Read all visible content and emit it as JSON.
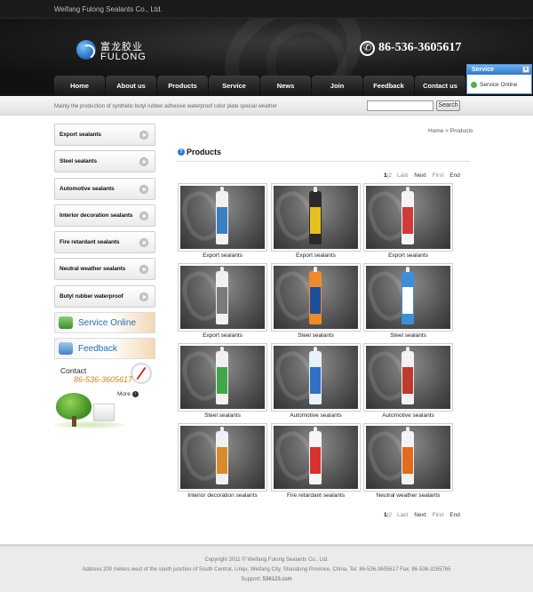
{
  "topbar": {
    "company": "Weifang Fulong Sealants Co., Ltd."
  },
  "logo": {
    "cn": "富龙胶业",
    "en": "FULONG"
  },
  "header": {
    "phone": "86-536-3605617"
  },
  "nav": [
    "Home",
    "About us",
    "Products",
    "Service",
    "News",
    "Join",
    "Feedback",
    "Contact us"
  ],
  "service_widget": {
    "title": "Service",
    "close": "x",
    "row": "Service Online"
  },
  "slogan": {
    "text": "Mainly the production of synthetic butyl rubber adhesive waterproof color plate special weather"
  },
  "search": {
    "placeholder": "",
    "button": "Search"
  },
  "sidebar": {
    "categories": [
      "Export sealants",
      "Steel sealants",
      "Automotive sealants",
      "Interior decoration sealants",
      "Fire retardant sealants",
      "Neutral weather sealants",
      "Butyl rubber waterproof"
    ],
    "service_banner": "Service Online",
    "feedback_banner": "Feedback",
    "contact": {
      "title": "Contact",
      "phone": "86-536-3605617",
      "more": "More"
    }
  },
  "breadcrumb": "Home > Products",
  "section_title": "Products",
  "pager": {
    "current": "1",
    "sep": "|",
    "page2": "2",
    "last": "Last",
    "next": "Next",
    "first": "First",
    "end": "End"
  },
  "products": [
    {
      "caption": "Export sealants",
      "color": "#f2f2f2",
      "band": "#3a7fc4"
    },
    {
      "caption": "Export sealants",
      "color": "#2b2b2b",
      "band": "#e6c21f"
    },
    {
      "caption": "Export sealants",
      "color": "#f4f4f4",
      "band": "#d23a3a"
    },
    {
      "caption": "Export sealants",
      "color": "#f1f1f1",
      "band": "#7a7a7a"
    },
    {
      "caption": "Steel sealants",
      "color": "#f08a2a",
      "band": "#1e4f9c"
    },
    {
      "caption": "Steel sealants",
      "color": "#3d8ed8",
      "band": "#ffffff"
    },
    {
      "caption": "Steel sealants",
      "color": "#f1f1f1",
      "band": "#3fa84a"
    },
    {
      "caption": "Automotive sealants",
      "color": "#e9f2fb",
      "band": "#2f6fc6"
    },
    {
      "caption": "Automotive sealants",
      "color": "#f2f2f2",
      "band": "#c0392b"
    },
    {
      "caption": "Interior decoration sealants",
      "color": "#f1f1f1",
      "band": "#d98a2b"
    },
    {
      "caption": "Fire retardant sealants",
      "color": "#f5f5f5",
      "band": "#d93030"
    },
    {
      "caption": "Neutral weather sealants",
      "color": "#f3f3f3",
      "band": "#e46a1c"
    }
  ],
  "footer": {
    "copyright": "Copyright 2011 © Weifang Fulong Sealants Co., Ltd.",
    "address": "Address 200 meters west of the south junction of South Central, Linqu, Weifang City, Shandong Province, China.   Tel: 86-536-3605617   Fax: 86-536-3155765",
    "support_label": "Support:",
    "support_link": "536123.com"
  }
}
